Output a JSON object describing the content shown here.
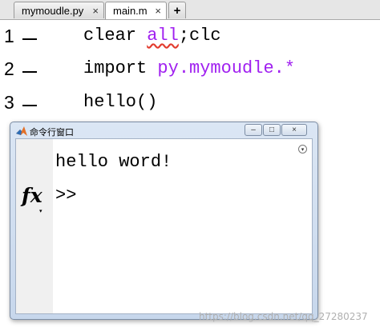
{
  "tabs": [
    {
      "label": "mymoudle.py",
      "close": "×",
      "active": false
    },
    {
      "label": "main.m",
      "close": "×",
      "active": true
    }
  ],
  "add_tab_label": "+",
  "editor": {
    "lines": [
      {
        "number": "1",
        "plain_a": "clear ",
        "keyword": "all",
        "plain_b": ";clc"
      },
      {
        "number": "2",
        "plain_a": "import ",
        "keyword": "py.mymoudle.*",
        "plain_b": ""
      },
      {
        "number": "3",
        "plain_a": "hello()",
        "keyword": "",
        "plain_b": ""
      }
    ]
  },
  "command_window": {
    "title": "命令行窗口",
    "output": "hello word!",
    "prompt": ">>",
    "fx_label": "fx",
    "fx_arrow": "▾",
    "buttons": {
      "minimize": "–",
      "maximize": "□",
      "close": "×"
    },
    "menu_glyph": "▾"
  },
  "watermark": "https://blog.csdn.net/qq_27280237",
  "colors": {
    "keyword": "#a020f0",
    "error_underline": "#e23b2e"
  }
}
